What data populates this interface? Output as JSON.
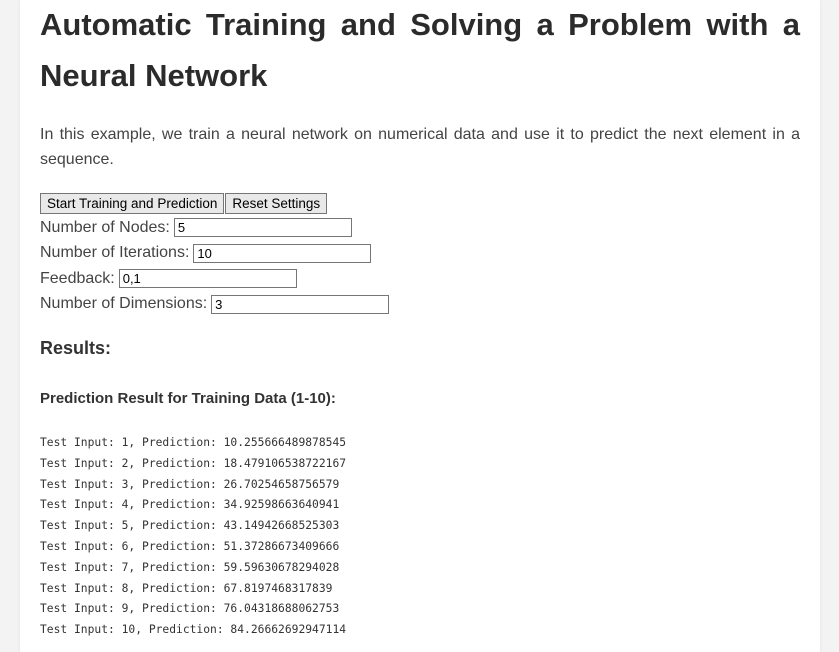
{
  "page": {
    "title": "Automatic Training and Solving a Problem with a Neural Network",
    "intro": "In this example, we train a neural network on numerical data and use it to predict the next element in a sequence."
  },
  "controls": {
    "start_label": "Start Training and Prediction",
    "reset_label": "Reset Settings",
    "fields": [
      {
        "label": "Number of Nodes:",
        "value": "5"
      },
      {
        "label": "Number of Iterations:",
        "value": "10"
      },
      {
        "label": "Feedback:",
        "value": "0,1"
      },
      {
        "label": "Number of Dimensions:",
        "value": "3"
      }
    ]
  },
  "results": {
    "heading": "Results:",
    "subheading": "Prediction Result for Training Data (1-10):",
    "lines": [
      "Test Input: 1, Prediction: 10.255666489878545",
      "Test Input: 2, Prediction: 18.479106538722167",
      "Test Input: 3, Prediction: 26.70254658756579",
      "Test Input: 4, Prediction: 34.92598663640941",
      "Test Input: 5, Prediction: 43.14942668525303",
      "Test Input: 6, Prediction: 51.37286673409666",
      "Test Input: 7, Prediction: 59.59630678294028",
      "Test Input: 8, Prediction: 67.8197468317839",
      "Test Input: 9, Prediction: 76.04318688062753",
      "Test Input: 10, Prediction: 84.26662692947114"
    ]
  }
}
